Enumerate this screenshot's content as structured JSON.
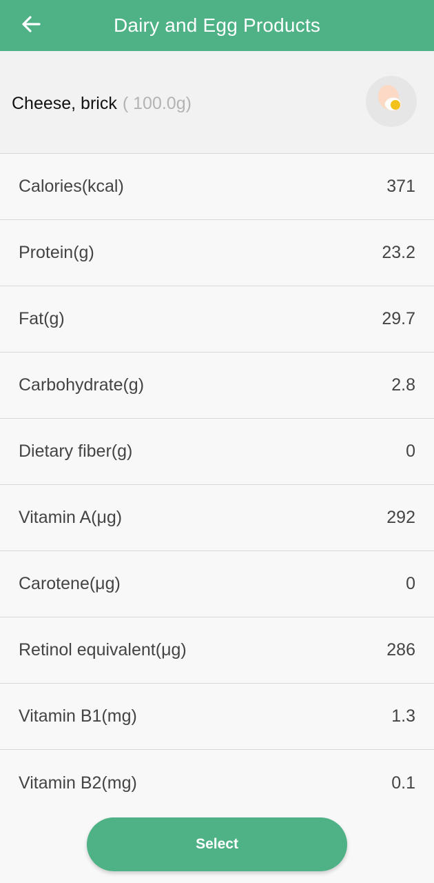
{
  "app_bar": {
    "title": "Dairy and Egg Products",
    "back_icon": "arrow-left-icon"
  },
  "food": {
    "name": "Cheese, brick",
    "weight": "( 100.0g)",
    "image_icon": "egg-icon"
  },
  "nutrients": [
    {
      "label": "Calories(kcal)",
      "value": "371"
    },
    {
      "label": "Protein(g)",
      "value": "23.2"
    },
    {
      "label": "Fat(g)",
      "value": "29.7"
    },
    {
      "label": "Carbohydrate(g)",
      "value": "2.8"
    },
    {
      "label": "Dietary fiber(g)",
      "value": "0"
    },
    {
      "label": "Vitamin A(μg)",
      "value": "292"
    },
    {
      "label": "Carotene(μg)",
      "value": "0"
    },
    {
      "label": "Retinol equivalent(μg)",
      "value": "286"
    },
    {
      "label": "Vitamin B1(mg)",
      "value": "1.3"
    },
    {
      "label": "Vitamin B2(mg)",
      "value": "0.1"
    }
  ],
  "footer": {
    "select_label": "Select"
  },
  "colors": {
    "brand_green": "#4fb286",
    "background": "#f8f8f8"
  }
}
